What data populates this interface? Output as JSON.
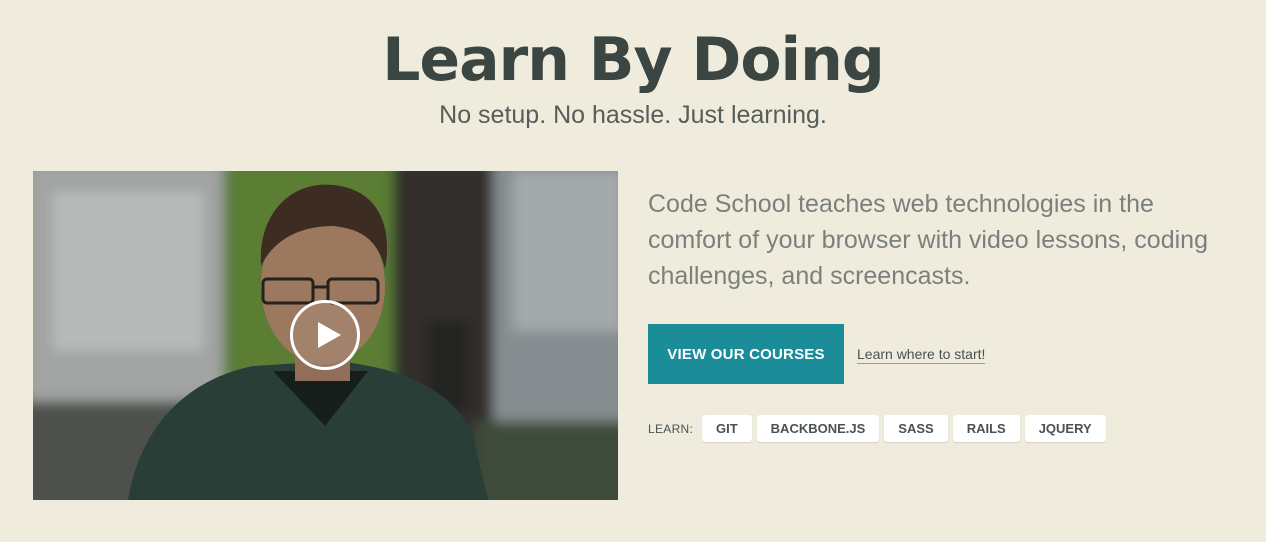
{
  "hero": {
    "title": "Learn By Doing",
    "subtitle": "No setup. No hassle. Just learning."
  },
  "video": {
    "play_icon": "play-circle-icon"
  },
  "intro": {
    "description": "Code School teaches web technologies in the comfort of your browser with video lessons, coding challenges, and screencasts.",
    "cta_label": "VIEW OUR COURSES",
    "start_link": "Learn where to start!"
  },
  "learn": {
    "label": "LEARN:",
    "tags": [
      "GIT",
      "BACKBONE.JS",
      "SASS",
      "RAILS",
      "JQUERY"
    ]
  },
  "colors": {
    "background": "#efecdd",
    "accent": "#1a8d99",
    "heading": "#3b4643"
  }
}
